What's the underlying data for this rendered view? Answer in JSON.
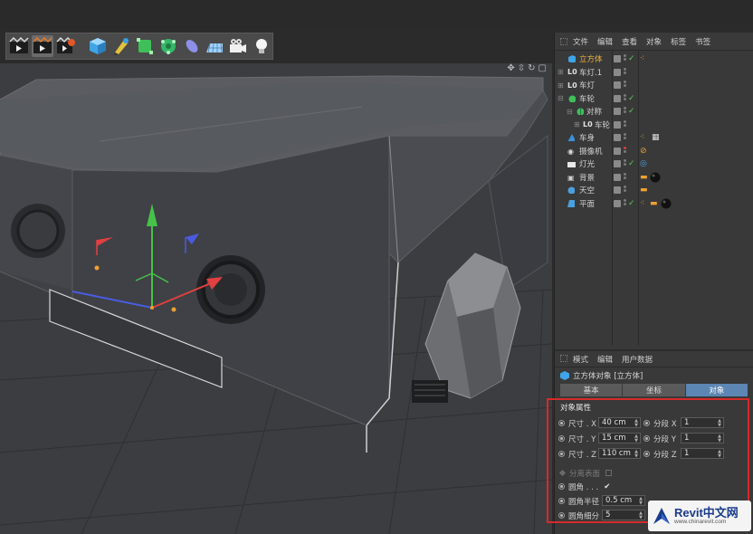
{
  "object_manager": {
    "menu": [
      "文件",
      "编辑",
      "查看",
      "对象",
      "标签",
      "书签"
    ],
    "objects": [
      {
        "name": "立方体",
        "selected": true
      },
      {
        "name": "车灯.1",
        "selected": false
      },
      {
        "name": "车灯",
        "selected": false
      },
      {
        "name": "车轮",
        "selected": false
      },
      {
        "name": "对称",
        "selected": false
      },
      {
        "name": "车轮",
        "selected": false
      },
      {
        "name": "车身",
        "selected": false
      },
      {
        "name": "摄像机",
        "selected": false
      },
      {
        "name": "灯光",
        "selected": false
      },
      {
        "name": "背景",
        "selected": false
      },
      {
        "name": "天空",
        "selected": false
      },
      {
        "name": "平面",
        "selected": false
      }
    ]
  },
  "attribute_manager": {
    "menu": [
      "模式",
      "编辑",
      "用户数据"
    ],
    "title": "立方体对象 [立方体]",
    "tabs": [
      "基本",
      "坐标",
      "对象"
    ],
    "active_tab": "对象",
    "section": "对象属性",
    "size_x_label": "尺寸 . X",
    "size_x": "40 cm",
    "size_y_label": "尺寸 . Y",
    "size_y": "15 cm",
    "size_z_label": "尺寸 . Z",
    "size_z": "110 cm",
    "seg_x_label": "分段 X",
    "seg_x": "1",
    "seg_y_label": "分段 Y",
    "seg_y": "1",
    "seg_z_label": "分段 Z",
    "seg_z": "1",
    "separate_label": "分离表面",
    "fillet_label": "圆角 . . .",
    "fillet_checked": "✔",
    "fillet_radius_label": "圆角半径",
    "fillet_radius": "0.5 cm",
    "fillet_subdiv_label": "圆角细分",
    "fillet_subdiv": "5"
  },
  "watermark": {
    "brand": "Revit中文网",
    "url": "www.chinarevit.com"
  },
  "colors": {
    "accent_blue": "#5c86b3",
    "highlight_red": "#d52a2a",
    "selected_orange": "#f0b43c"
  }
}
